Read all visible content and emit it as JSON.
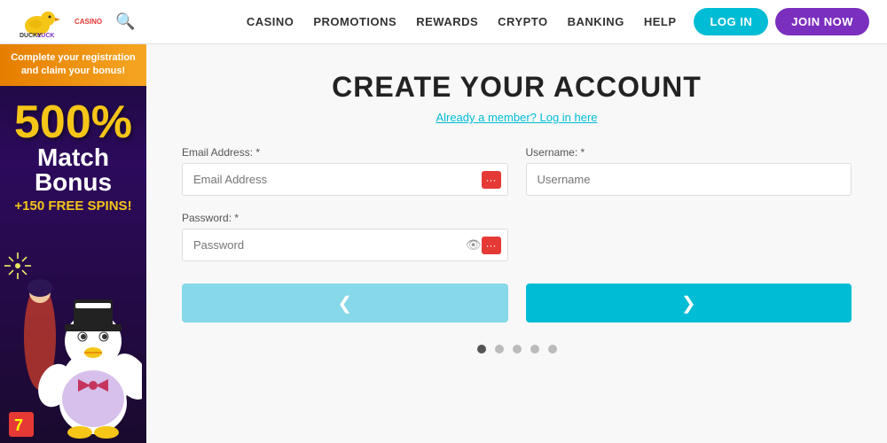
{
  "header": {
    "logo_alt": "DuckLuck Casino",
    "search_icon": "🔍",
    "nav_items": [
      {
        "label": "CASINO",
        "id": "casino"
      },
      {
        "label": "PROMOTIONS",
        "id": "promotions"
      },
      {
        "label": "REWARDS",
        "id": "rewards"
      },
      {
        "label": "CRYPTO",
        "id": "crypto"
      },
      {
        "label": "BANKING",
        "id": "banking"
      },
      {
        "label": "HELP",
        "id": "help"
      }
    ],
    "btn_login": "LOG IN",
    "btn_join": "JOIN NOW"
  },
  "sidebar": {
    "banner_text": "Complete your registration and claim your bonus!",
    "bonus_pct": "500%",
    "bonus_match": "Match",
    "bonus_label": "Bonus",
    "free_spins": "+150 FREE SPINS!"
  },
  "form": {
    "title": "CREATE YOUR ACCOUNT",
    "already_member": "Already a member? Log in here",
    "email_label": "Email Address: *",
    "email_placeholder": "Email Address",
    "username_label": "Username: *",
    "username_placeholder": "Username",
    "password_label": "Password: *",
    "password_placeholder": "Password",
    "btn_prev_icon": "❮",
    "btn_next_icon": "❯",
    "dots": [
      {
        "active": true
      },
      {
        "active": false
      },
      {
        "active": false
      },
      {
        "active": false
      },
      {
        "active": false
      }
    ]
  }
}
